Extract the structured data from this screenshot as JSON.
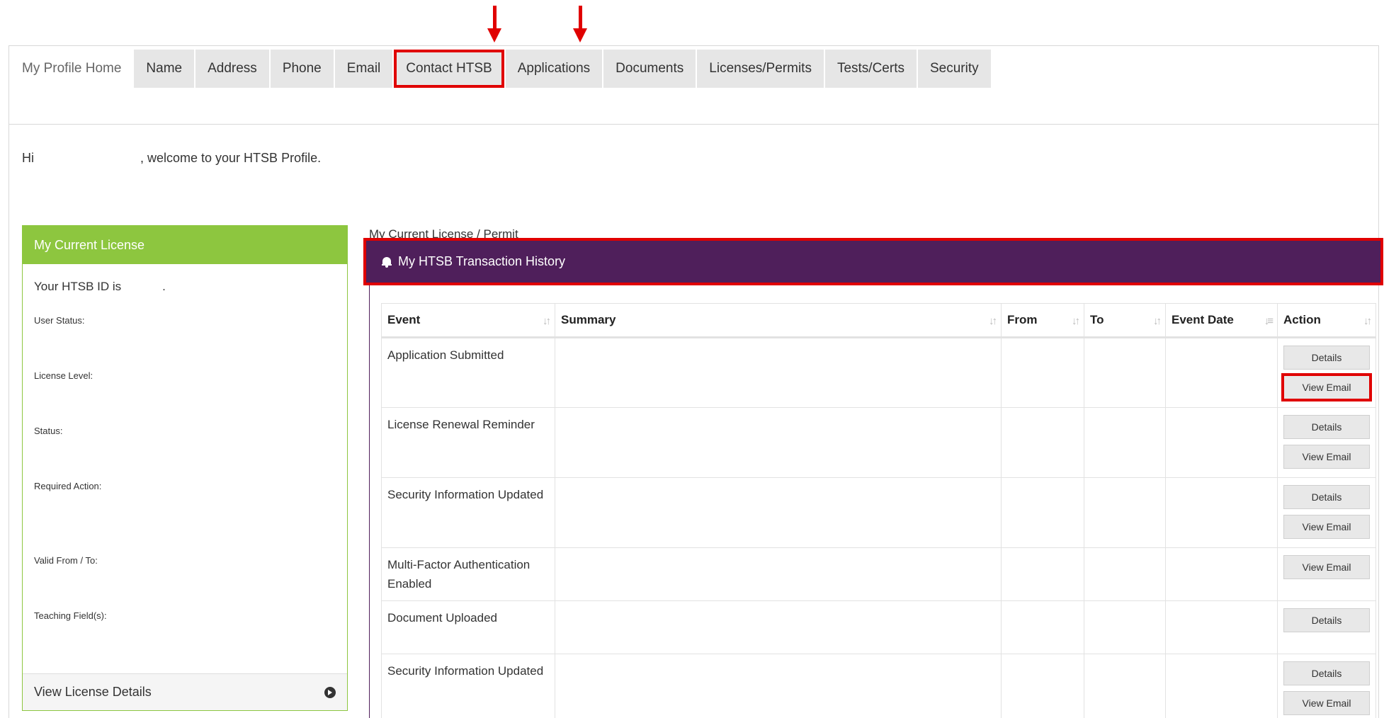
{
  "nav": {
    "tabs": [
      {
        "label": "My Profile Home",
        "active": true
      },
      {
        "label": "Name"
      },
      {
        "label": "Address"
      },
      {
        "label": "Phone"
      },
      {
        "label": "Email"
      },
      {
        "label": "Contact HTSB",
        "highlighted": true
      },
      {
        "label": "Applications"
      },
      {
        "label": "Documents"
      },
      {
        "label": "Licenses/Permits"
      },
      {
        "label": "Tests/Certs"
      },
      {
        "label": "Security"
      }
    ]
  },
  "welcome": {
    "prefix": "Hi",
    "suffix": ", welcome to your HTSB Profile."
  },
  "license_panel": {
    "title": "My Current License",
    "id_prefix": "Your HTSB ID is",
    "id_suffix": ".",
    "fields": [
      "User Status:",
      "License Level:",
      "Status:",
      "Required Action:",
      "Valid From / To:",
      "Teaching Field(s):"
    ],
    "footer_link": "View License Details"
  },
  "current_label": "My Current License / Permit",
  "history": {
    "title": "My HTSB Transaction History",
    "columns": [
      "Event",
      "Summary",
      "From",
      "To",
      "Event Date",
      "Action"
    ],
    "rows": [
      {
        "event": "Application Submitted",
        "actions": [
          "Details",
          "View Email"
        ],
        "highlight_view_email": true
      },
      {
        "event": "License Renewal Reminder",
        "actions": [
          "Details",
          "View Email"
        ]
      },
      {
        "event": "Security Information Updated",
        "actions": [
          "Details",
          "View Email"
        ]
      },
      {
        "event": "Multi-Factor Authentication Enabled",
        "actions": [
          "View Email"
        ]
      },
      {
        "event": "Document Uploaded",
        "actions": [
          "Details"
        ]
      },
      {
        "event": "Security Information Updated",
        "actions": [
          "Details",
          "View Email"
        ]
      }
    ]
  },
  "colors": {
    "license_green": "#8dc63f",
    "history_purple": "#4f1f5b",
    "annotation_red": "#e00000"
  }
}
